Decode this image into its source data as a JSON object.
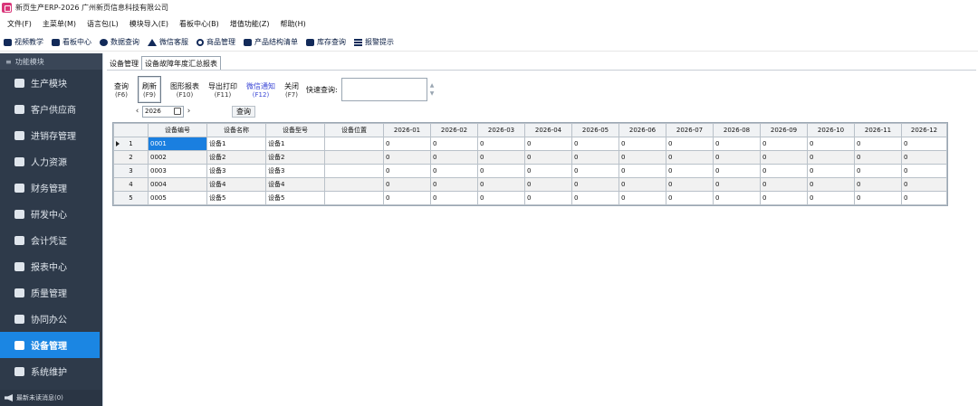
{
  "title": "新页生产ERP-2026 广州新页信息科技有限公司",
  "menu": [
    "文件(F)",
    "主菜单(M)",
    "语言包(L)",
    "模块导入(E)",
    "看板中心(B)",
    "增值功能(Z)",
    "帮助(H)"
  ],
  "toolbar": [
    {
      "label": "视频教学",
      "icon": "video-icon"
    },
    {
      "label": "看板中心",
      "icon": "dashboard-icon"
    },
    {
      "label": "数据查询",
      "icon": "chat-icon"
    },
    {
      "label": "微信客服",
      "icon": "warning-triangle-icon"
    },
    {
      "label": "商品管理",
      "icon": "search-icon"
    },
    {
      "label": "产品结构清单",
      "icon": "camera-icon"
    },
    {
      "label": "库存查询",
      "icon": "users-icon"
    },
    {
      "label": "报警提示",
      "icon": "list-icon"
    }
  ],
  "sidebar": {
    "header": "功能模块",
    "items": [
      {
        "label": "生产模块",
        "icon": "book-icon",
        "active": false
      },
      {
        "label": "客户供应商",
        "icon": "users-icon",
        "active": false
      },
      {
        "label": "进销存管理",
        "icon": "cart-icon",
        "active": false
      },
      {
        "label": "人力资源",
        "icon": "id-card-icon",
        "active": false
      },
      {
        "label": "财务管理",
        "icon": "money-icon",
        "active": false
      },
      {
        "label": "研发中心",
        "icon": "grid-icon",
        "active": false
      },
      {
        "label": "会计凭证",
        "icon": "stamp-icon",
        "active": false
      },
      {
        "label": "报表中心",
        "icon": "chart-icon",
        "active": false
      },
      {
        "label": "质量管理",
        "icon": "grid-icon",
        "active": false
      },
      {
        "label": "协同办公",
        "icon": "cooperation-icon",
        "active": false
      },
      {
        "label": "设备管理",
        "icon": "tools-icon",
        "active": true
      },
      {
        "label": "系统维护",
        "icon": "gears-icon",
        "active": false
      }
    ],
    "footer": "最新未读消息(0)"
  },
  "tabs": [
    {
      "label": "设备管理",
      "active": false
    },
    {
      "label": "设备故障年度汇总报表",
      "active": true
    }
  ],
  "actions": [
    {
      "label": "查询",
      "key": "(F6)",
      "style": ""
    },
    {
      "label": "刷新",
      "key": "(F9)",
      "style": "selected"
    },
    {
      "label": "图形报表",
      "key": "(F10)",
      "style": ""
    },
    {
      "label": "导出打印",
      "key": "(F11)",
      "style": ""
    },
    {
      "label": "微信通知",
      "key": "(F12)",
      "style": "wechat"
    },
    {
      "label": "关闭",
      "key": "(F7)",
      "style": ""
    }
  ],
  "quick_search": {
    "label": "快速查询:",
    "value": ""
  },
  "year": "2026",
  "query_button": "查询",
  "table": {
    "columns": [
      "设备编号",
      "设备名称",
      "设备型号",
      "设备位置",
      "2026-01",
      "2026-02",
      "2026-03",
      "2026-04",
      "2026-05",
      "2026-06",
      "2026-07",
      "2026-08",
      "2026-09",
      "2026-10",
      "2026-11",
      "2026-12"
    ],
    "rows": [
      {
        "n": "1",
        "cells": [
          "0001",
          "设备1",
          "设备1",
          "",
          "0",
          "0",
          "0",
          "0",
          "0",
          "0",
          "0",
          "0",
          "0",
          "0",
          "0",
          "0"
        ]
      },
      {
        "n": "2",
        "cells": [
          "0002",
          "设备2",
          "设备2",
          "",
          "0",
          "0",
          "0",
          "0",
          "0",
          "0",
          "0",
          "0",
          "0",
          "0",
          "0",
          "0"
        ]
      },
      {
        "n": "3",
        "cells": [
          "0003",
          "设备3",
          "设备3",
          "",
          "0",
          "0",
          "0",
          "0",
          "0",
          "0",
          "0",
          "0",
          "0",
          "0",
          "0",
          "0"
        ]
      },
      {
        "n": "4",
        "cells": [
          "0004",
          "设备4",
          "设备4",
          "",
          "0",
          "0",
          "0",
          "0",
          "0",
          "0",
          "0",
          "0",
          "0",
          "0",
          "0",
          "0"
        ]
      },
      {
        "n": "5",
        "cells": [
          "0005",
          "设备5",
          "设备5",
          "",
          "0",
          "0",
          "0",
          "0",
          "0",
          "0",
          "0",
          "0",
          "0",
          "0",
          "0",
          "0"
        ]
      }
    ]
  }
}
